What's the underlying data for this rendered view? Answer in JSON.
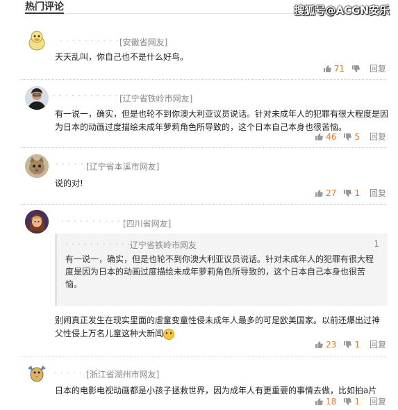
{
  "header": {
    "title": "热门评论",
    "watermark": "搜狐号@ACGN安乐"
  },
  "comments": [
    {
      "location": "[安徽省网友]",
      "text": "天天乱叫，你自己也不是什么好鸟。",
      "likes": "71",
      "dislikes": "",
      "reply_label": "回复"
    },
    {
      "location": "[辽宁省铁岭市网友]",
      "text": "有一说一，确实，但是也轮不到你澳大利亚议员说话。针对未成年人的犯罪有很大程度是因为日本的动画过度描绘未成年萝莉角色所导致的，这个日本自己本身也很苦恼。",
      "likes": "46",
      "dislikes": "5",
      "reply_label": "回复"
    },
    {
      "location": "[辽宁省本溪市网友]",
      "text": "说的对!",
      "likes": "27",
      "dislikes": "1",
      "reply_label": "回复"
    },
    {
      "location": "[四川省网友]",
      "quote": {
        "location": "辽宁省铁岭市网友",
        "floor": "1",
        "text": "有一说一，确实，但是也轮不到你澳大利亚议员说话。针对未成年人的犯罪有很大程度是因为日本的动画过度描绘未成年萝莉角色所导致的，这个日本自己本身也很苦恼。"
      },
      "text": "别闹真正发生在现实里面的虐童变童性侵未成年人最多的可是欧美国家。以前还爆出过神父性侵上万名儿童这种大新闻",
      "likes": "23",
      "dislikes": "1",
      "reply_label": "回复"
    },
    {
      "location": "[浙江省湖州市网友]",
      "text": "日本的电影电视动画都是小孩子拯救世界，因为成年人有更重要的事情去做，比如拍a片",
      "likes": "18",
      "dislikes": "1",
      "reply_label": "回复"
    }
  ]
}
